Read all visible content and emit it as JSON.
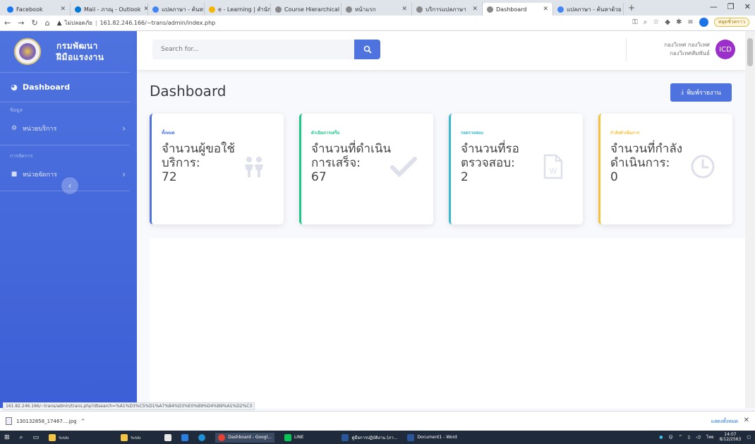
{
  "browser": {
    "tabs": [
      {
        "label": "Facebook",
        "color": "#1877f2"
      },
      {
        "label": "Mail - ภาณุ - Outlook",
        "color": "#0078d4"
      },
      {
        "label": "แปลภาษา - ค้นหาด้วย G",
        "color": "#4285f4"
      },
      {
        "label": "e - Learning | สำนักงาน",
        "color": "#f4b400"
      },
      {
        "label": "Course Hierarchical",
        "color": "#555555"
      },
      {
        "label": "หน้าแรก",
        "color": "#555555"
      },
      {
        "label": "บริการแปลภาษา",
        "color": "#555555"
      },
      {
        "label": "Dashboard",
        "color": "#555555"
      },
      {
        "label": "แปลภาษา - ค้นหาด้วย G",
        "color": "#4285f4"
      }
    ],
    "url_security": "ไม่ปลอดภัย",
    "url": "161.82.246.166/~trans/admin/index.php",
    "pause_label": "หยุดชั่วคราว",
    "status_url": "161.82.246.166/~trans/admin/trans.php?dtsearch=%A1%D3%C5%D1%A7%B4%D3%E0%B9%D4%B9%A1%D2%C3"
  },
  "sidebar": {
    "brand_line1": "กรมพัฒนา",
    "brand_line2": "ฝีมือแรงงาน",
    "dashboard_label": "Dashboard",
    "heading1": "ข้อมูล",
    "item1_label": "หน่วยบริการ",
    "heading2": "การจัดการ",
    "item2_label": "หน่วยจัดการ"
  },
  "topbar": {
    "search_placeholder": "Search for...",
    "user_name": "กองวิเทศ กองวิเทศ",
    "user_role": "กองวิเทศสัมพันธ์",
    "avatar_text": "ICD"
  },
  "page": {
    "title": "Dashboard",
    "report_button": "พิมพ์รายงาน"
  },
  "cards": [
    {
      "label": "ทั้งหมด",
      "title": "จำนวนผู้ขอใช้บริการ:",
      "value": "72",
      "color": "#4e73df"
    },
    {
      "label": "ดำเนินการเสร็จ",
      "title": "จำนวนที่ดำเนินการเสร็จ:",
      "value": "67",
      "color": "#1cc88a"
    },
    {
      "label": "รอตรวจสอบ",
      "title": "จำนวนที่รอตรวจสอบ:",
      "value": "2",
      "color": "#36b9cc"
    },
    {
      "label": "กำลังดำเนินการ",
      "title": "จำนวนที่กำลังดำเนินการ:",
      "value": "0",
      "color": "#f6c23e"
    }
  ],
  "downloads": {
    "file_name": "130132858_17467....jpg",
    "show_all": "แสดงทั้งหมด"
  },
  "taskbar": {
    "items": [
      "ระบบ",
      "ระบบ",
      "Dashboard - Googl...",
      "LINE",
      "คู่มือการปฏิบัติงาน (ภา...",
      "Document1 - Word"
    ],
    "time": "14:07",
    "date": "8/12/2563",
    "lang": "ไทย"
  }
}
